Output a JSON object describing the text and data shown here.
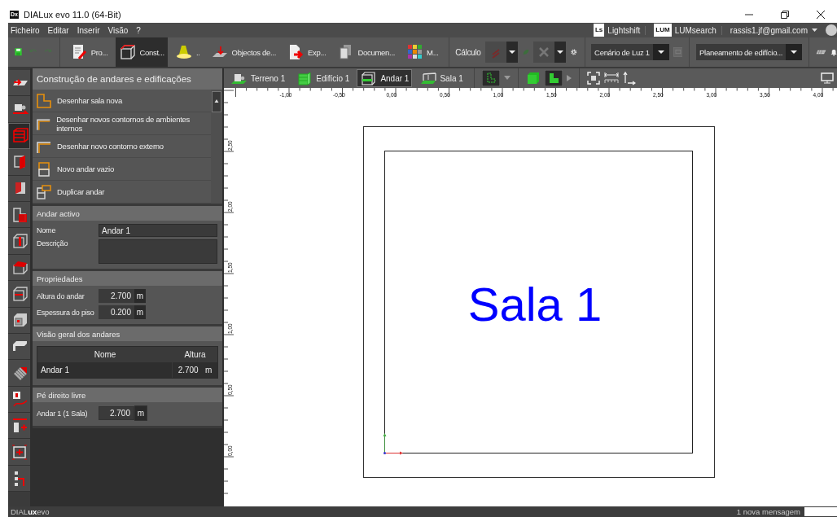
{
  "window": {
    "app_icon": "Dx",
    "title": "DIALux evo 11.0  (64-Bit)"
  },
  "menu": [
    "Ficheiro",
    "Editar",
    "Inserir",
    "Visão",
    "?"
  ],
  "account": {
    "services": [
      {
        "badge": "Ls",
        "label": "Lightshift"
      },
      {
        "badge": "LUM",
        "label": "LUMsearch"
      }
    ],
    "email": "rassis1.jf@gmail.com"
  },
  "quick_actions": [
    {
      "kind": "save",
      "disabled": false
    },
    {
      "kind": "undo",
      "disabled": true
    },
    {
      "kind": "redo",
      "disabled": true
    }
  ],
  "modes": [
    {
      "kind": "project",
      "label": "Pro...",
      "selected": false
    },
    {
      "kind": "construction",
      "label": "Const...",
      "selected": true
    },
    {
      "kind": "lights",
      "label": "..",
      "selected": false
    },
    {
      "kind": "objects",
      "label": "Objectos de...",
      "selected": false
    },
    {
      "kind": "export",
      "label": "Exp...",
      "selected": false
    },
    {
      "kind": "documents",
      "label": "Documen...",
      "selected": false
    },
    {
      "kind": "materials",
      "label": "M...",
      "selected": false
    }
  ],
  "calculation": {
    "label": "Cálculo",
    "scene": "Cenário de Luz 1",
    "planning": "Planeamento de edifício..."
  },
  "rail": [
    {
      "kind": "import",
      "selected": false
    },
    {
      "kind": "site",
      "selected": false
    },
    {
      "kind": "floors",
      "selected": true
    },
    {
      "kind": "wall",
      "selected": false
    },
    {
      "kind": "door",
      "selected": false
    },
    {
      "kind": "room",
      "selected": false
    },
    {
      "kind": "height",
      "selected": false
    },
    {
      "kind": "roof",
      "selected": false
    },
    {
      "kind": "cut",
      "selected": false
    },
    {
      "kind": "window",
      "selected": false
    },
    {
      "kind": "ceiling",
      "selected": false
    },
    {
      "kind": "hatch",
      "selected": false
    },
    {
      "kind": "text",
      "selected": false
    },
    {
      "kind": "column",
      "selected": false
    },
    {
      "kind": "frame",
      "selected": false
    },
    {
      "kind": "path",
      "selected": false
    }
  ],
  "panel": {
    "title": "Construção de andares e edificações",
    "actions": [
      {
        "kind": "room",
        "label": "Desenhar sala nova"
      },
      {
        "kind": "contour",
        "label": "Desenhar novos contornos de ambientes internos"
      },
      {
        "kind": "contour",
        "label": "Desenhar novo contorno externo"
      },
      {
        "kind": "floor",
        "label": "Novo andar vazio"
      },
      {
        "kind": "duplicate",
        "label": "Duplicar andar"
      }
    ],
    "active_floor": {
      "title": "Andar activo",
      "name_label": "Nome",
      "name_value": "Andar 1",
      "description_label": "Descrição"
    },
    "properties": {
      "title": "Propriedades",
      "rows": [
        {
          "label": "Altura do andar",
          "value": "2.700",
          "unit": "m"
        },
        {
          "label": "Espessura do piso",
          "value": "0.200",
          "unit": "m"
        }
      ]
    },
    "overview": {
      "title": "Visão geral dos andares",
      "columns": [
        "Nome",
        "Altura"
      ],
      "rows": [
        {
          "name": "Andar 1",
          "value": "2.700",
          "unit": "m"
        }
      ]
    },
    "clear_height": {
      "title": "Pé direito livre",
      "label": "Andar 1 (1 Sala)",
      "value": "2.700",
      "unit": "m"
    }
  },
  "view_tabs": [
    {
      "kind": "site",
      "label": "Terreno 1",
      "selected": false
    },
    {
      "kind": "building",
      "label": "Edifício 1",
      "selected": false
    },
    {
      "kind": "floor",
      "label": "Andar 1",
      "selected": true
    },
    {
      "kind": "room",
      "label": "Sala 1",
      "selected": false
    }
  ],
  "ruler": {
    "x_labels": [
      "-1,00",
      "-0,50",
      "0,00",
      "0,50",
      "1,00",
      "1,50",
      "2,00",
      "2,50",
      "3,00",
      "3,50",
      "4,00"
    ],
    "y_labels": [
      "2,50",
      "2,00",
      "1,50",
      "1,00",
      "0,50",
      "0,00"
    ]
  },
  "drawing": {
    "room_label": "Sala 1"
  },
  "status_bar": {
    "brand": "DIAL**ux**evo",
    "message": "1 nova mensagem"
  }
}
